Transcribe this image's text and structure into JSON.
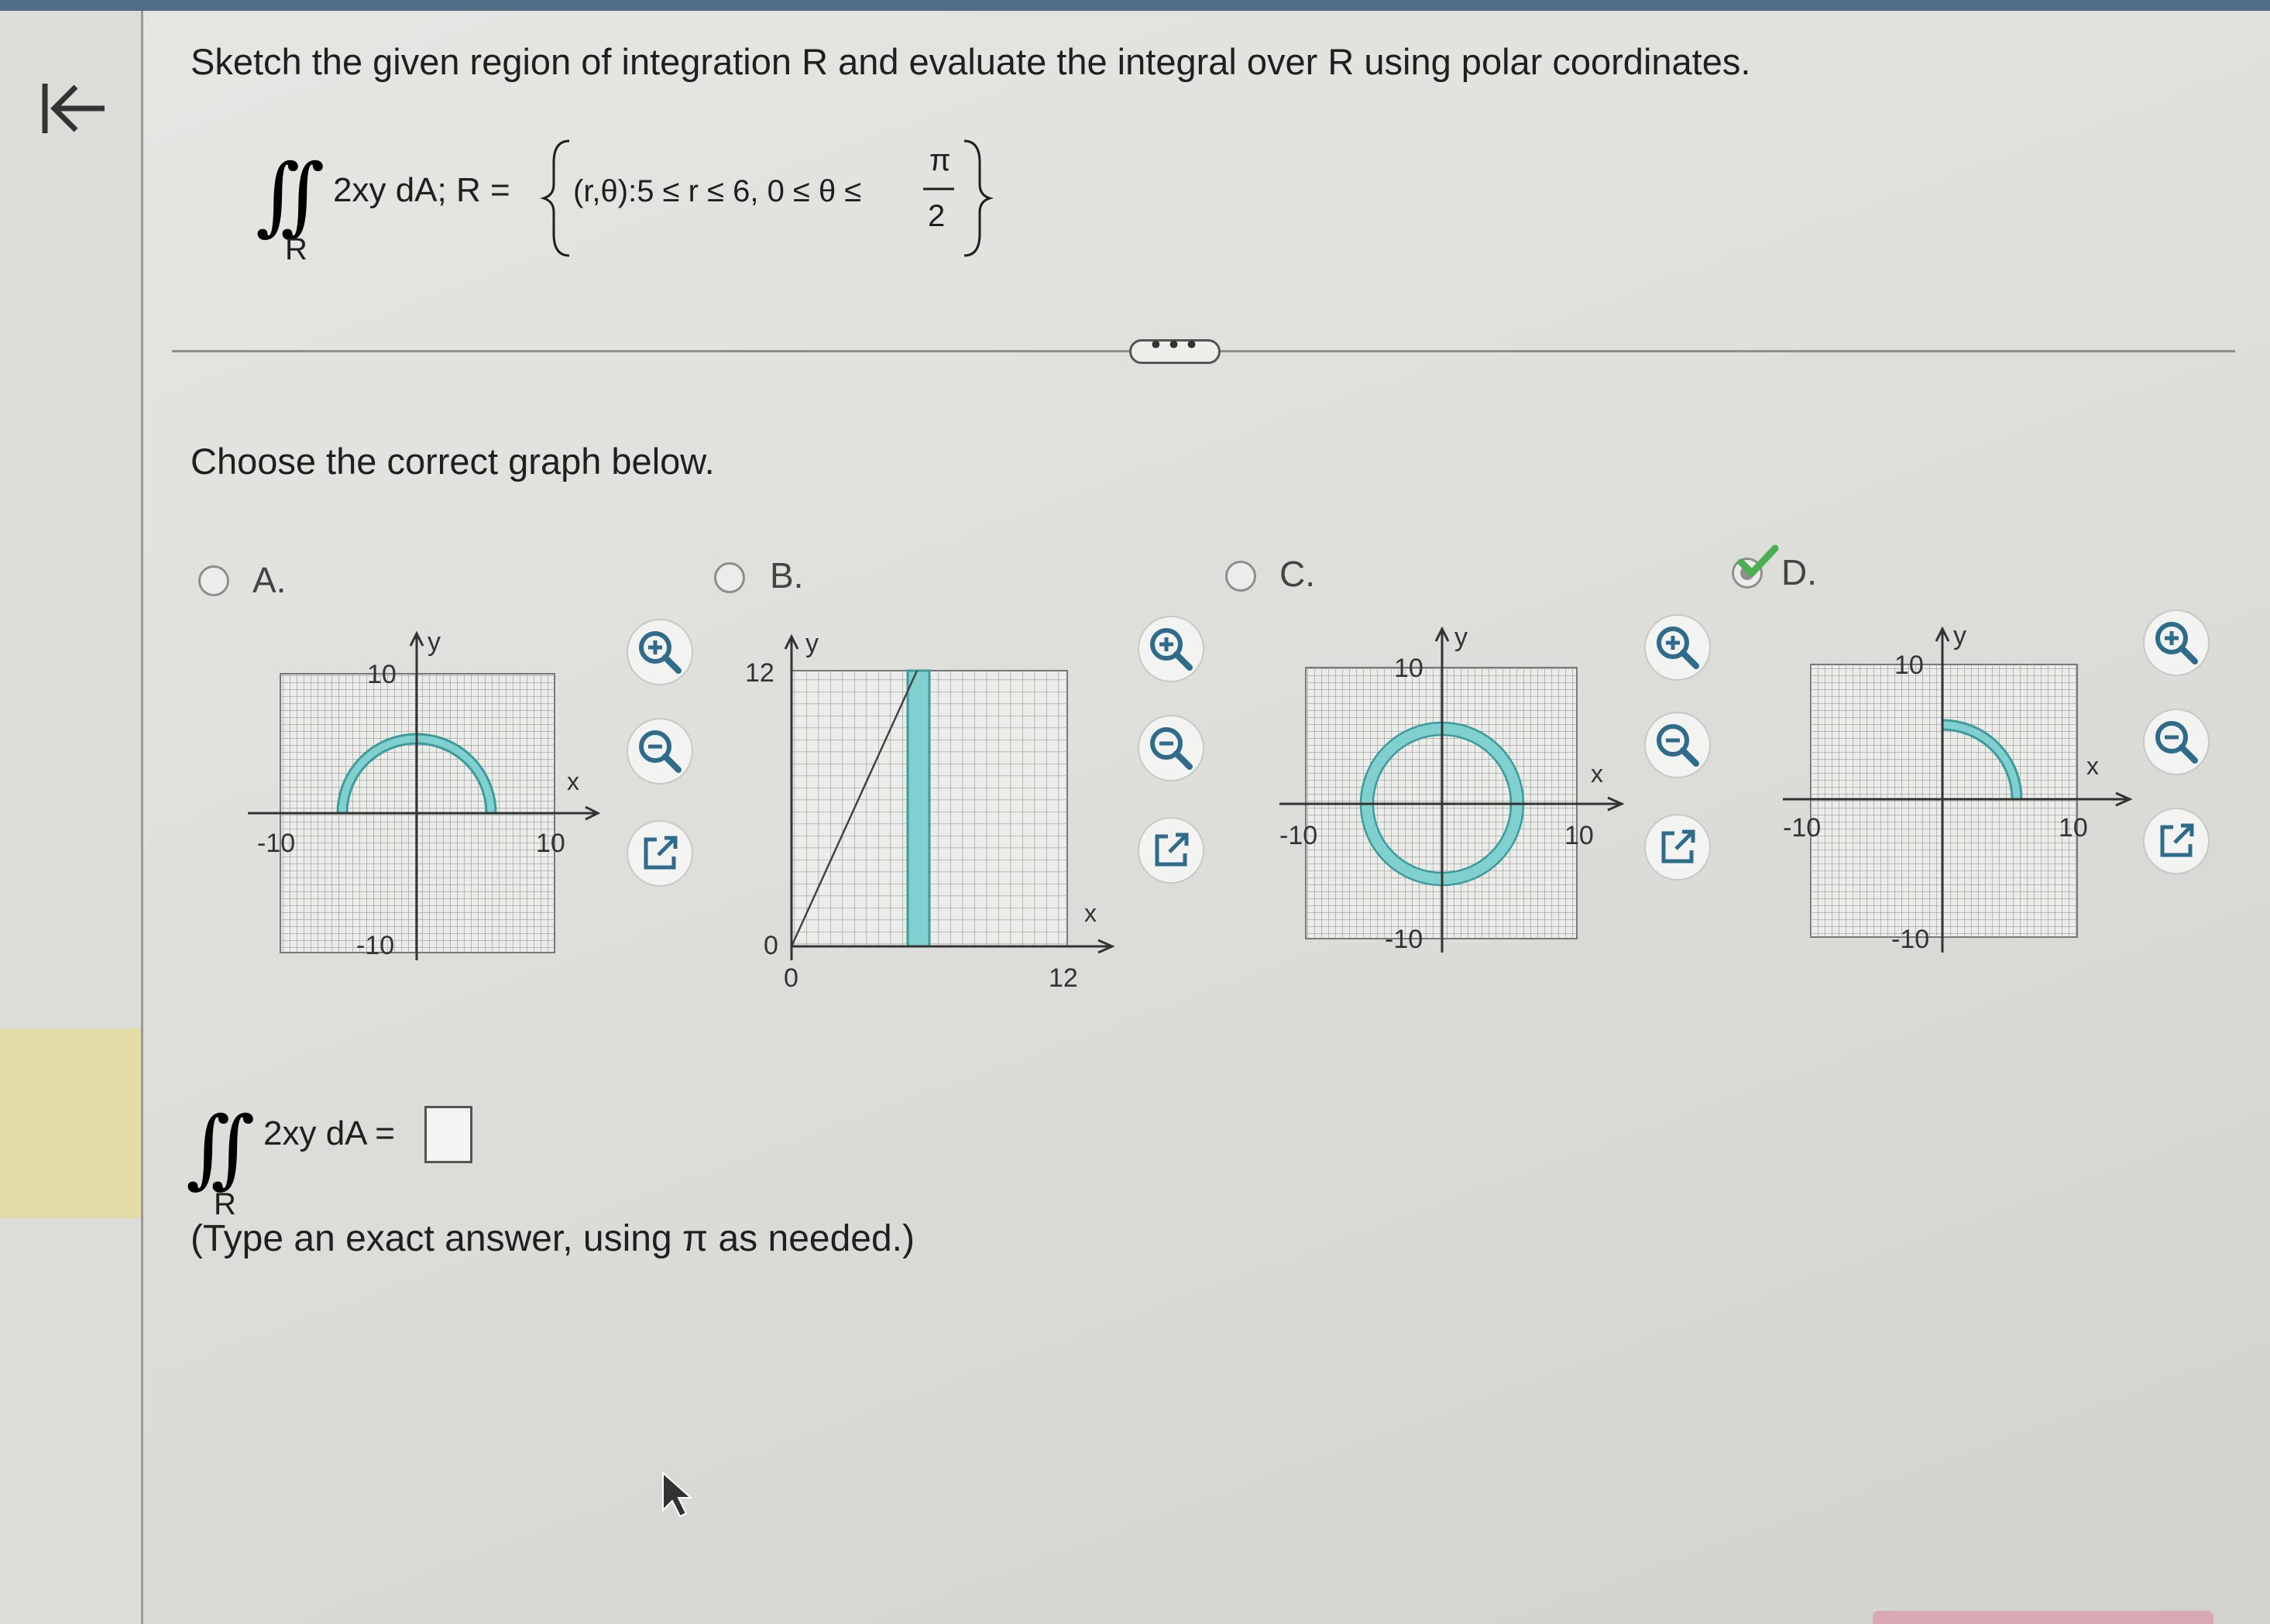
{
  "question": {
    "title": "Sketch the given region of integration R and evaluate the integral over R using polar coordinates.",
    "integrand": "2xy dA; R =",
    "region_subscript": "R",
    "set_def": "(r,θ):5 ≤ r ≤ 6, 0 ≤ θ ≤",
    "pi": "π",
    "two": "2"
  },
  "more_label": "•••",
  "prompt": "Choose the correct graph below.",
  "options": [
    {
      "label": "A.",
      "selected": false
    },
    {
      "label": "B.",
      "selected": false
    },
    {
      "label": "C.",
      "selected": false
    },
    {
      "label": "D.",
      "selected": true
    }
  ],
  "graphs": {
    "a": {
      "ytick": "10",
      "xneg": "-10",
      "xpos": "10",
      "yneg": "-10",
      "xlabel": "x",
      "ylabel": "y"
    },
    "b": {
      "ytick": "12",
      "yzero": "0",
      "xzero": "0",
      "xtick": "12",
      "xlabel": "x",
      "ylabel": "y"
    },
    "c": {
      "ytick": "10",
      "xneg": "-10",
      "xpos": "10",
      "yneg": "-10",
      "xlabel": "x",
      "ylabel": "y"
    },
    "d": {
      "ytick": "10",
      "xneg": "-10",
      "xpos": "10",
      "yneg": "-10",
      "xlabel": "x",
      "ylabel": "y"
    }
  },
  "answer": {
    "expression": "2xy dA =",
    "subscript": "R",
    "value": "",
    "hint": "(Type an exact answer, using π as needed.)"
  },
  "colors": {
    "region_fill": "#7fd0cf",
    "region_stroke": "#3d9c9b",
    "grid": "#9a9a9a",
    "check": "#4caf50"
  },
  "icons": [
    "collapse-panel-icon",
    "zoom-in-icon",
    "zoom-out-icon",
    "open-new-window-icon",
    "checkmark-icon"
  ]
}
